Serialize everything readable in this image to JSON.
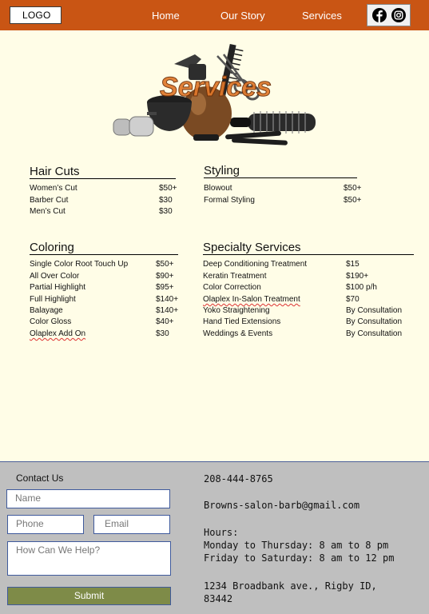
{
  "header": {
    "logo": "LOGO",
    "nav": [
      "Home",
      "Our Story",
      "Services"
    ],
    "social_icons": [
      "facebook-icon",
      "instagram-icon"
    ],
    "color": "#c95514"
  },
  "hero": {
    "title": "Services"
  },
  "haircuts": {
    "title": "Hair Cuts",
    "items": [
      {
        "name": "Women’s Cut",
        "price": "$50+"
      },
      {
        "name": "Barber Cut",
        "price": "$30"
      },
      {
        "name": "Men’s Cut",
        "price": "$30"
      }
    ]
  },
  "styling": {
    "title": "Styling",
    "items": [
      {
        "name": "Blowout",
        "price": "$50+"
      },
      {
        "name": "Formal Styling",
        "price": "$50+"
      }
    ]
  },
  "coloring": {
    "title": "Coloring",
    "items": [
      {
        "name": "Single Color Root Touch Up",
        "price": "$50+"
      },
      {
        "name": "All Over Color",
        "price": "$90+"
      },
      {
        "name": "Partial Highlight",
        "price": "$95+"
      },
      {
        "name": "Full Highlight",
        "price": "$140+"
      },
      {
        "name": "Balayage",
        "price": "$140+"
      },
      {
        "name": "Color Gloss",
        "price": "$40+"
      },
      {
        "name": "Olaplex Add On",
        "price": "$30"
      }
    ]
  },
  "specialty": {
    "title": "Specialty Services",
    "items": [
      {
        "name": "Deep Conditioning Treatment",
        "price": "$15"
      },
      {
        "name": "Keratin Treatment",
        "price": "$190+"
      },
      {
        "name": "Color Correction",
        "price": "$100 p/h"
      },
      {
        "name": "Olaplex In-Salon Treatment",
        "price": "$70"
      },
      {
        "name": "Yoko Straightening",
        "price": "By Consultation"
      },
      {
        "name": "Hand Tied Extensions",
        "price": "By Consultation"
      },
      {
        "name": "Weddings & Events",
        "price": "By Consultation"
      }
    ]
  },
  "contact": {
    "title": "Contact Us",
    "name_placeholder": "Name",
    "phone_placeholder": "Phone",
    "email_placeholder": "Email",
    "message_placeholder": "How Can We Help?",
    "submit": "Submit"
  },
  "info": {
    "phone": "208-444-8765",
    "email": "Browns-salon-barb@gmail.com",
    "hours_label": "Hours:",
    "hours_1": "Monday to Thursday: 8 am to 8 pm",
    "hours_2": "Friday to Saturday: 8 am to 12 pm",
    "address_1": "1234 Broadbank ave., Rigby ID,",
    "address_2": "83442"
  }
}
